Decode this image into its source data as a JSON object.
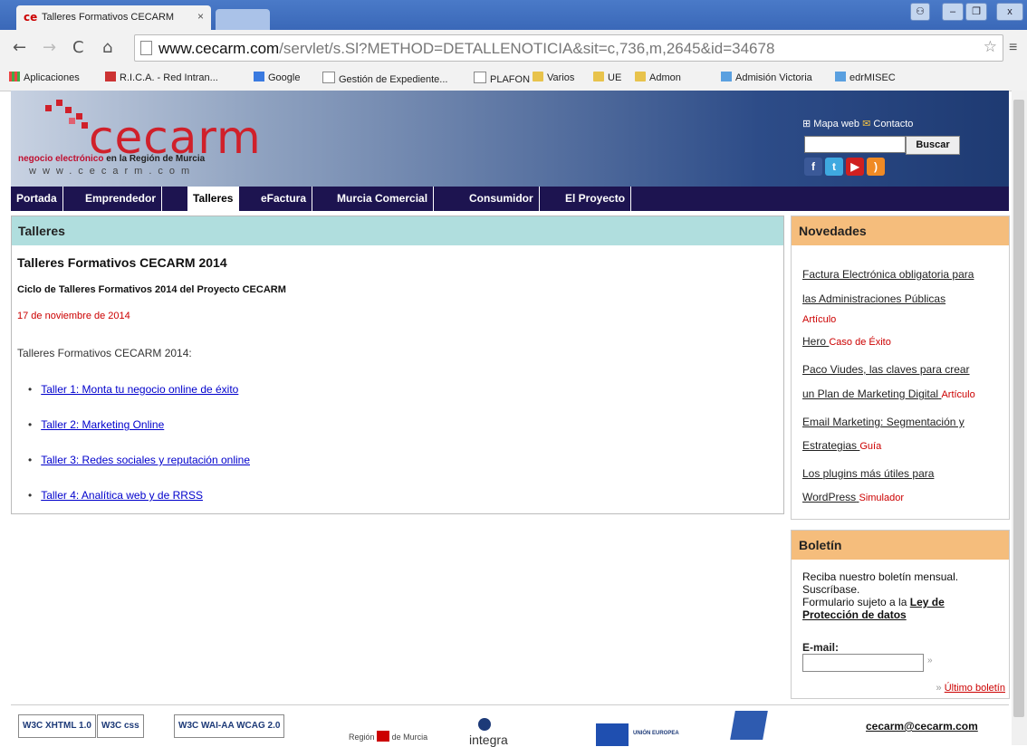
{
  "browser": {
    "tab_title": "Talleres Formativos CECARM",
    "tab_close": "×",
    "url_host": "www.cecarm.com",
    "url_path": "/servlet/s.Sl?METHOD=DETALLENOTICIA&sit=c,736,m,2645&id=34678",
    "bookmarks": [
      "Aplicaciones",
      "R.I.C.A. - Red Intran...",
      "Google",
      "Gestión de Expediente...",
      "PLAFON",
      "Varios",
      "UE",
      "Admon",
      "Admisión Victoria",
      "edrMISEC"
    ]
  },
  "header": {
    "logo": "cecarm",
    "tagline_red": "negocio electrónico",
    "tagline_rest": " en la Región de Murcia",
    "www": "www.cecarm.com",
    "mapa": "Mapa web",
    "contacto": "Contacto",
    "search_button": "Buscar"
  },
  "nav": [
    "Portada",
    "Emprendedor",
    "Talleres",
    "eFactura",
    "Murcia Comercial",
    "Consumidor",
    "El Proyecto"
  ],
  "main": {
    "heading": "Talleres",
    "title": "Talleres Formativos CECARM 2014",
    "subtitle": "Ciclo de Talleres Formativos 2014 del Proyecto CECARM",
    "date": "17 de noviembre de 2014",
    "intro": "Talleres Formativos CECARM 2014:",
    "talleres": [
      "Taller 1: Monta tu negocio online de éxito",
      "Taller 2: Marketing Online",
      "Taller 3: Redes sociales y reputación online",
      "Taller 4: Analítica web y de RRSS"
    ]
  },
  "novedades": {
    "heading": "Novedades",
    "lines": [
      {
        "text": "Factura Electrónica obligatoria para",
        "tag": ""
      },
      {
        "text": "las Administraciones Públicas",
        "tag": ""
      },
      {
        "text": "",
        "tag": "Artículo"
      },
      {
        "text": "Hero",
        "tag": "Caso de Éxito"
      },
      {
        "text": "Paco Viudes, las claves para crear",
        "tag": ""
      },
      {
        "text": "un Plan de Marketing Digital",
        "tag": "Artículo"
      },
      {
        "text": "Email Marketing: Segmentación y",
        "tag": ""
      },
      {
        "text": "Estrategias",
        "tag": "Guía"
      },
      {
        "text": "Los plugins más útiles para",
        "tag": ""
      },
      {
        "text": "WordPress",
        "tag": "Simulador"
      }
    ]
  },
  "boletin": {
    "heading": "Boletín",
    "text1": "Reciba nuestro boletín mensual.",
    "text2": "Suscríbase.",
    "text3": "Formulario sujeto a la",
    "ley": "Ley de Protección de datos",
    "email_label": "E-mail:",
    "ultimo": "Último boletín"
  },
  "footer": {
    "badges": [
      "W3C XHTML 1.0",
      "W3C css",
      "W3C WAI-AA WCAG 2.0"
    ],
    "region_left": "Región",
    "region_right": "de Murcia",
    "integra": "integra",
    "ue": "UNIÓN EUROPEA",
    "email": "cecarm@cecarm.com"
  }
}
